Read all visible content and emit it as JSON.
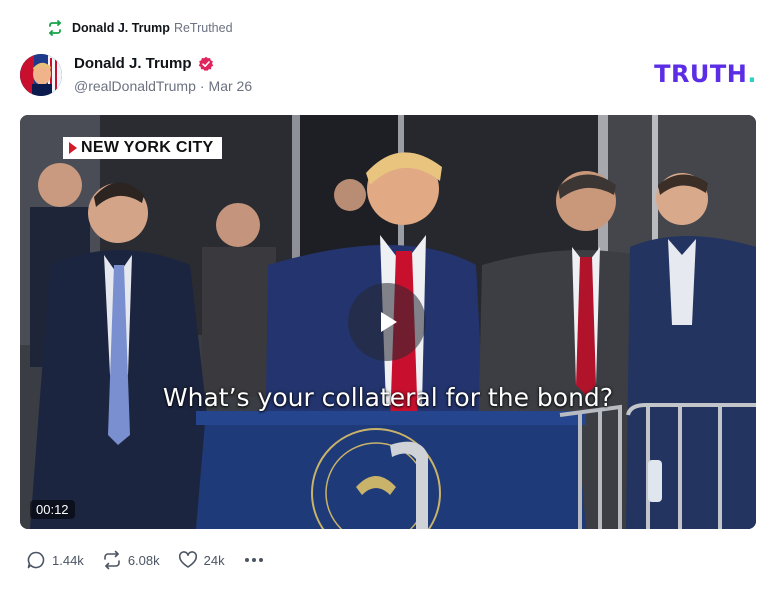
{
  "retruth": {
    "name": "Donald J. Trump",
    "action": "ReTruthed"
  },
  "post": {
    "author_name": "Donald J. Trump",
    "handle": "@realDonaldTrump",
    "separator": "·",
    "date": "Mar 26"
  },
  "brand": {
    "logo_text": "TRUTH",
    "logo_dot": ".",
    "color": "#5b2ee6",
    "dot_color": "#2fd1c0"
  },
  "video": {
    "location_tag": "NEW YORK CITY",
    "caption": "What’s your collateral for the bond?",
    "podium_text": "State of New York",
    "duration": "00:12"
  },
  "stats": {
    "replies": "1.44k",
    "retruths": "6.08k",
    "likes": "24k"
  },
  "icons": {
    "retruth": "retruth-icon",
    "verified": "verified-badge-icon",
    "reply": "reply-icon",
    "like": "heart-icon",
    "more": "more-icon",
    "play": "play-icon"
  }
}
